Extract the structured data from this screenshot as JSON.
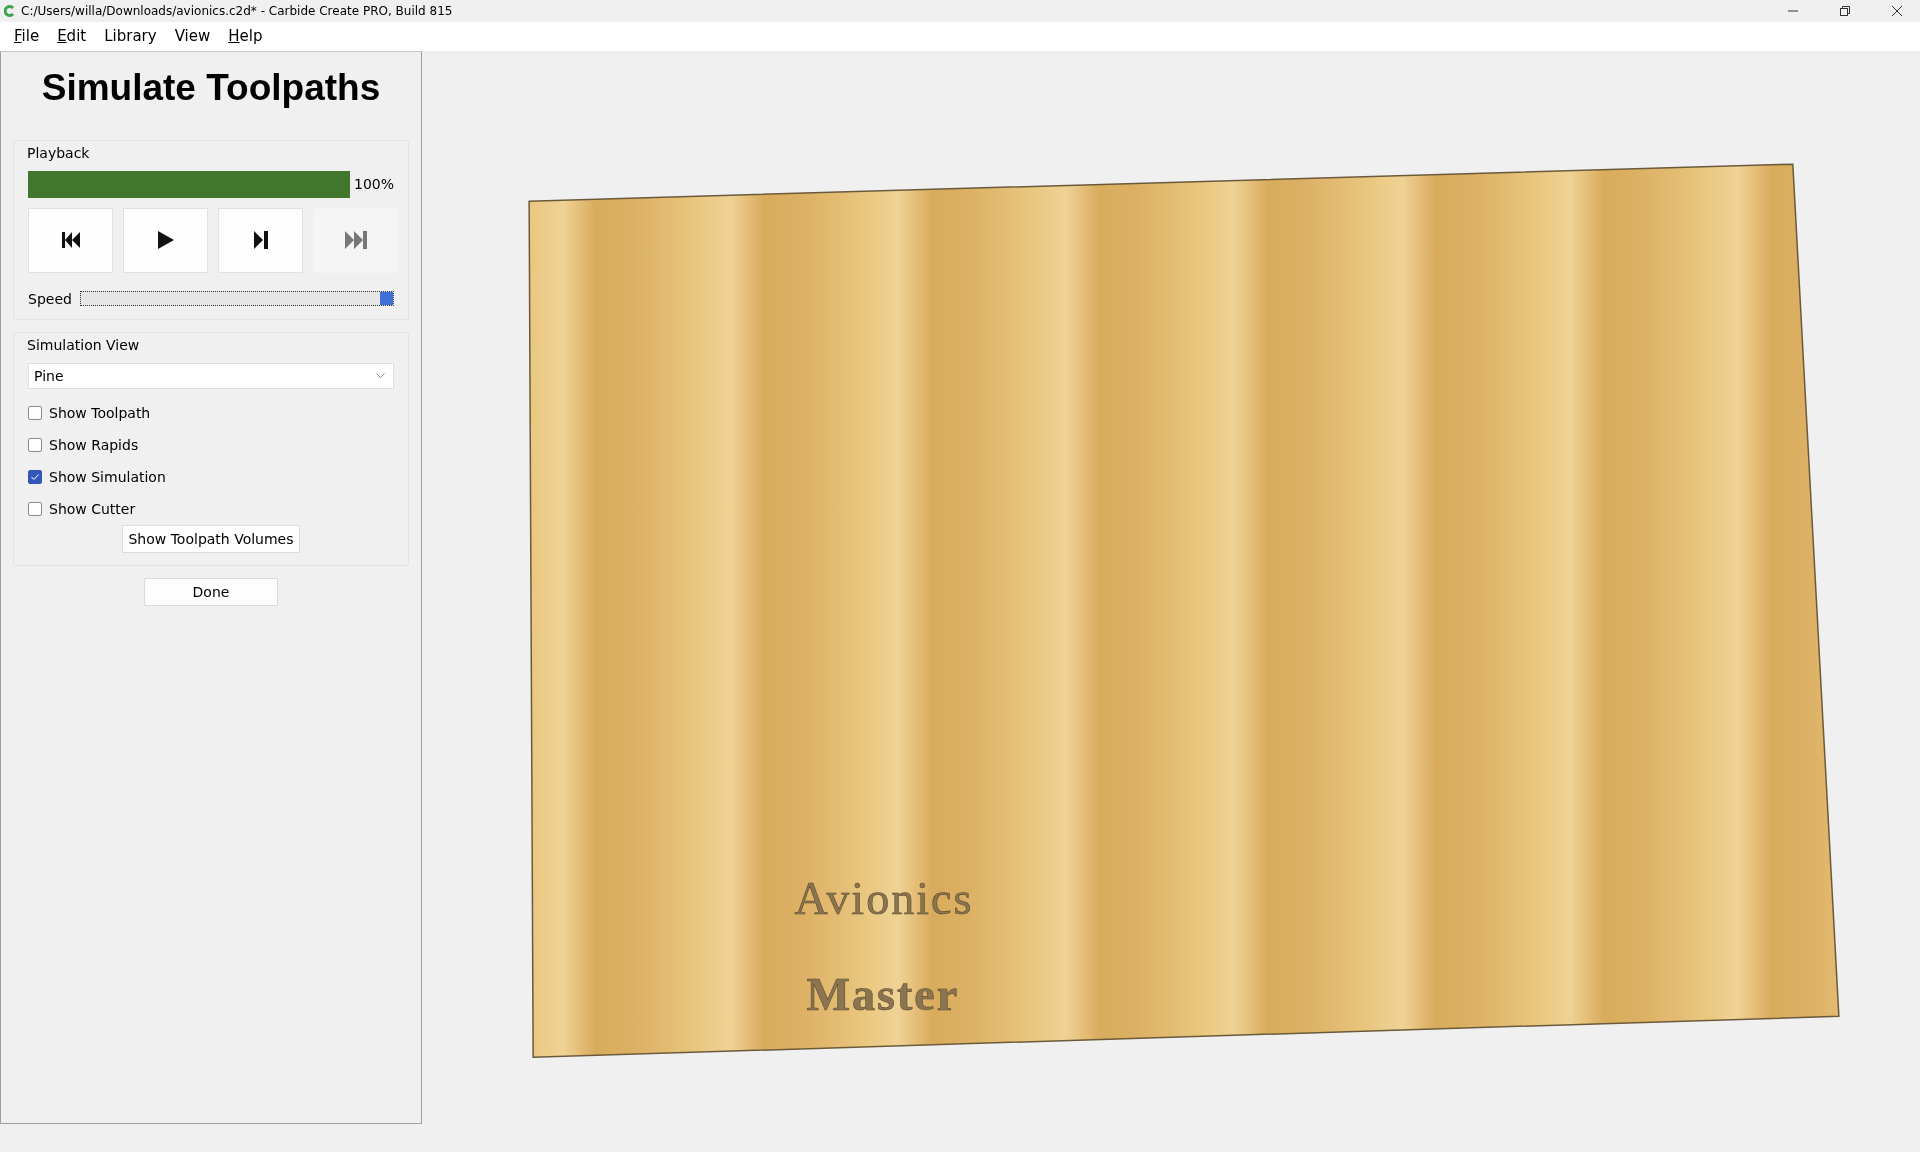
{
  "window": {
    "title": "C:/Users/willa/Downloads/avionics.c2d* - Carbide Create PRO, Build 815"
  },
  "menu": [
    {
      "label": "File",
      "underlined": true
    },
    {
      "label": "Edit",
      "underlined": true
    },
    {
      "label": "Library",
      "underlined": false
    },
    {
      "label": "View",
      "underlined": false
    },
    {
      "label": "Help",
      "underlined": true
    }
  ],
  "panel": {
    "title": "Simulate Toolpaths",
    "playback": {
      "label": "Playback",
      "progress": {
        "level": 1,
        "reading": "100%"
      },
      "buttons": [
        {
          "kind": "skip-start",
          "disabled": false
        },
        {
          "kind": "play",
          "disabled": false
        },
        {
          "kind": "step",
          "disabled": false
        },
        {
          "kind": "skip-end",
          "disabled": true
        }
      ],
      "speed": {
        "label": "Speed",
        "level": 1
      }
    },
    "simulation_view": {
      "label": "Simulation View",
      "material": {
        "value": "Pine"
      },
      "options": [
        {
          "label": "Show Toolpath",
          "checked": false
        },
        {
          "label": "Show Rapids",
          "checked": false
        },
        {
          "label": "Show Simulation",
          "checked": true
        },
        {
          "label": "Show Cutter",
          "checked": false
        }
      ],
      "volumes_button": "Show Toolpath Volumes"
    },
    "done_button": "Done"
  },
  "board": {
    "texts": [
      {
        "text": "Avionics",
        "bold": false
      },
      {
        "text": "Master",
        "bold": true
      }
    ]
  }
}
